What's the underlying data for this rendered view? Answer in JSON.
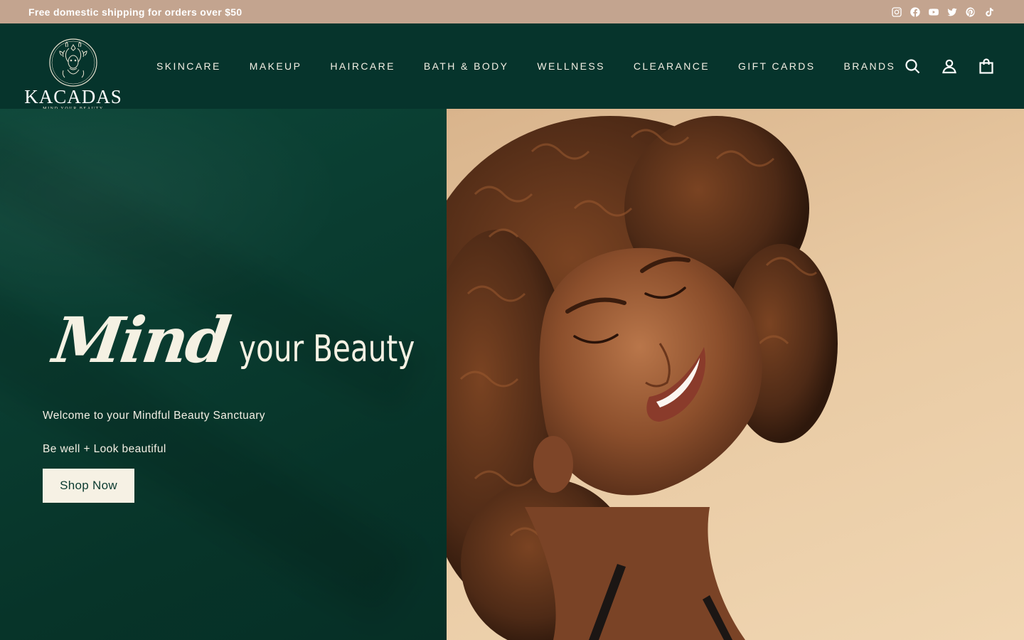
{
  "announcement": {
    "text": "Free domestic shipping for orders over $50",
    "social_icons": [
      "instagram-icon",
      "facebook-icon",
      "youtube-icon",
      "twitter-icon",
      "pinterest-icon",
      "tiktok-icon"
    ]
  },
  "header": {
    "logo": {
      "name": "KACADAS",
      "tagline": "MIND YOUR BEAUTY"
    },
    "nav": [
      {
        "label": "SKINCARE"
      },
      {
        "label": "MAKEUP"
      },
      {
        "label": "HAIRCARE"
      },
      {
        "label": "BATH & BODY"
      },
      {
        "label": "WELLNESS"
      },
      {
        "label": "CLEARANCE"
      },
      {
        "label": "GIFT CARDS"
      },
      {
        "label": "BRANDS"
      }
    ],
    "icons": [
      "search-icon",
      "account-icon",
      "cart-icon"
    ]
  },
  "hero": {
    "title_script": "Mind",
    "title_rest": "your Beauty",
    "subtitle_1": "Welcome to your Mindful Beauty Sanctuary",
    "subtitle_2": "Be well + Look beautiful",
    "cta_label": "Shop Now"
  },
  "colors": {
    "announcement_bg": "#c3a48f",
    "header_bg": "#06342c",
    "hero_bg": "#0b3a30",
    "cream": "#f6f1e4",
    "image_bg": "#e8c9a2"
  }
}
